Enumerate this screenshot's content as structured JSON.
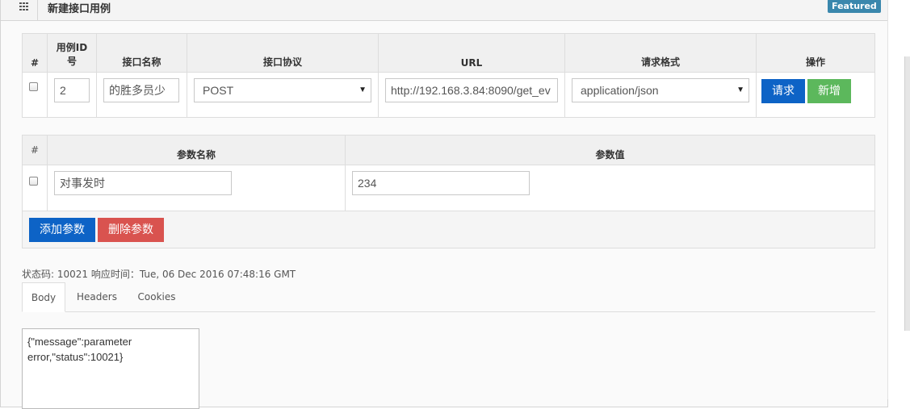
{
  "header": {
    "title": "新建接口用例",
    "badge": "Featured",
    "grid_icon": "grid-icon"
  },
  "case_table": {
    "columns": [
      "#",
      "用例ID号",
      "接口名称",
      "接口协议",
      "URL",
      "请求格式",
      "操作"
    ],
    "row": {
      "checked": false,
      "case_id": "2",
      "name": "的胜多员少",
      "protocol": "POST",
      "url": "http://192.168.3.84:8090/get_ev",
      "format": "application/json"
    },
    "request_button": "请求",
    "add_button": "新增"
  },
  "param_table": {
    "columns": [
      "#",
      "参数名称",
      "参数值"
    ],
    "row": {
      "checked": false,
      "name": "对事发时",
      "value": "234"
    },
    "add_param_button": "添加参数",
    "delete_param_button": "删除参数"
  },
  "response": {
    "status_line": "状态码: 10021 响应时间：Tue, 06 Dec 2016 07:48:16 GMT",
    "tabs": [
      "Body",
      "Headers",
      "Cookies"
    ],
    "active_tab": "Body",
    "body_text": "{\"message\":parameter error,\"status\":10021}"
  },
  "colors": {
    "primary": "#0d63c6",
    "success": "#5cb85c",
    "danger": "#d9534f",
    "badge": "#3a87ad"
  }
}
